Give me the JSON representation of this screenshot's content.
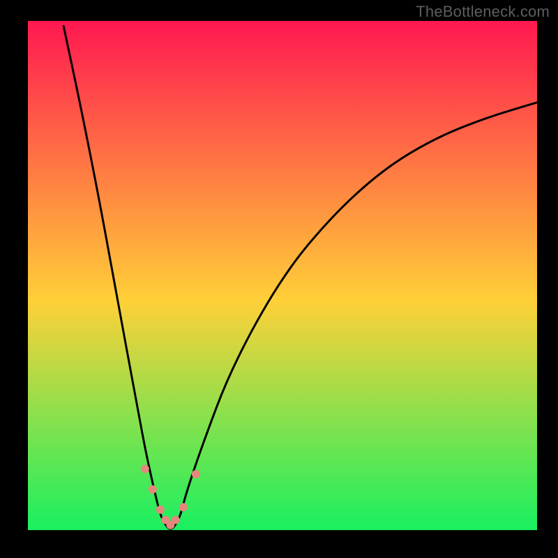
{
  "watermark": {
    "text": "TheBottleneck.com"
  },
  "chart_data": {
    "type": "line",
    "title": "",
    "xlabel": "",
    "ylabel": "",
    "xlim": [
      0,
      100
    ],
    "ylim": [
      0,
      100
    ],
    "grid": false,
    "legend": false,
    "background_gradient": {
      "top_color": "#ff1850",
      "mid_color": "#ffd038",
      "bottom_color": "#18f060"
    },
    "series": [
      {
        "name": "bottleneck-curve",
        "description": "V-shaped curve; y is % bottleneck vs normalized x. Minimum (0%) near x≈26–30.",
        "x": [
          7,
          10,
          14,
          18,
          21,
          23,
          25,
          26,
          27,
          28,
          29,
          30,
          31,
          34,
          40,
          50,
          60,
          70,
          80,
          90,
          100
        ],
        "values": [
          99,
          85,
          65,
          43,
          27,
          16,
          7,
          3,
          1,
          0,
          1,
          3,
          7,
          16,
          32,
          50,
          62,
          71,
          77,
          81,
          84
        ]
      }
    ],
    "markers": {
      "name": "highlight-points",
      "description": "Small salmon dots clustered near the curve minimum",
      "points": [
        {
          "x": 23.0,
          "y": 12.0
        },
        {
          "x": 24.5,
          "y": 8.0
        },
        {
          "x": 26.0,
          "y": 4.0
        },
        {
          "x": 27.0,
          "y": 2.0
        },
        {
          "x": 28.0,
          "y": 1.0
        },
        {
          "x": 29.0,
          "y": 2.0
        },
        {
          "x": 30.5,
          "y": 4.5
        },
        {
          "x": 33.0,
          "y": 11.0
        }
      ],
      "radius": 6,
      "color": "#e4877d"
    }
  }
}
